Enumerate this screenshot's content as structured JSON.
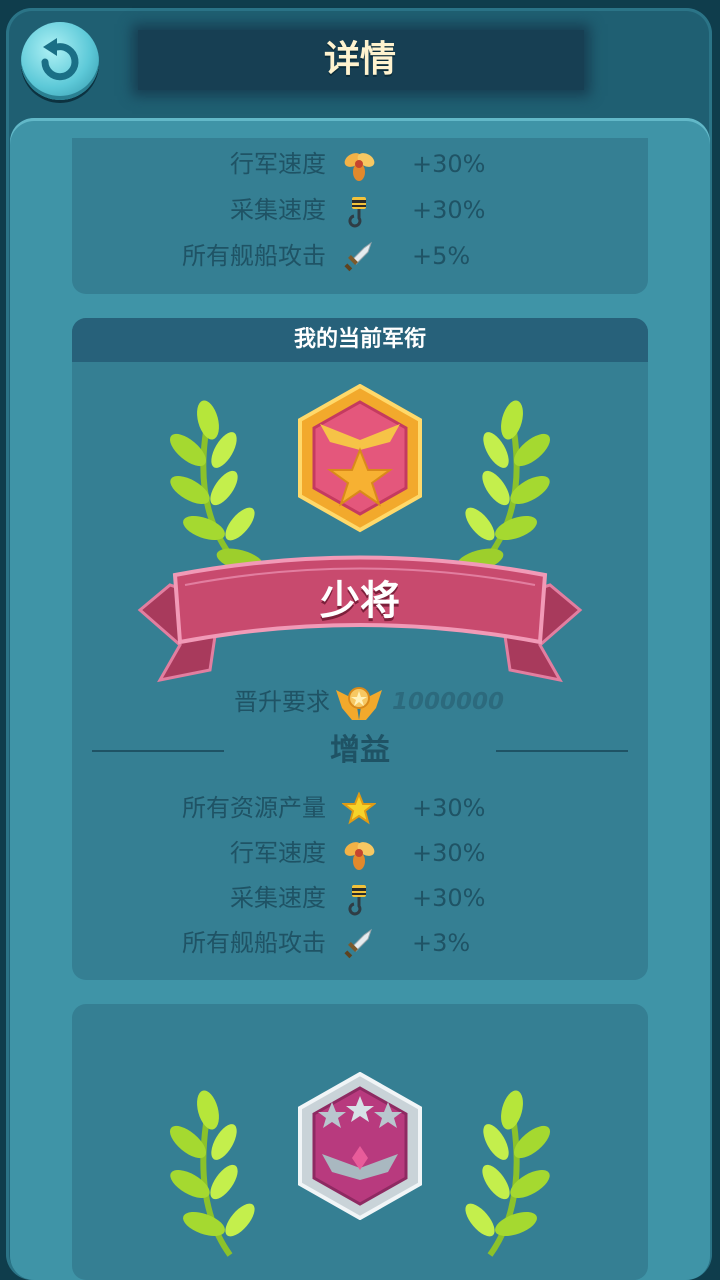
{
  "header": {
    "title": "详情",
    "back_icon": "back-arrow-icon"
  },
  "top_card": {
    "rows": [
      {
        "label": "行军速度",
        "icon": "propeller-icon",
        "value": "+30%"
      },
      {
        "label": "采集速度",
        "icon": "crane-hook-icon",
        "value": "+30%"
      },
      {
        "label": "所有舰船攻击",
        "icon": "sword-icon",
        "value": "+5%"
      }
    ]
  },
  "current_rank": {
    "header": "我的当前军衔",
    "rank_name": "少将",
    "badge_icon": "rank-badge-star-icon",
    "promotion_label": "晋升要求",
    "promotion_icon": "wings-emblem-icon",
    "promotion_value": "1000000",
    "gain_title": "增益",
    "rows": [
      {
        "label": "所有资源产量",
        "icon": "star-icon",
        "value": "+30%"
      },
      {
        "label": "行军速度",
        "icon": "propeller-icon",
        "value": "+30%"
      },
      {
        "label": "采集速度",
        "icon": "crane-hook-icon",
        "value": "+30%"
      },
      {
        "label": "所有舰船攻击",
        "icon": "sword-icon",
        "value": "+3%"
      }
    ]
  },
  "next_rank": {
    "badge_icon": "rank-badge-three-stars-icon"
  },
  "colors": {
    "panel": "#3f94a7",
    "card": "#357f93",
    "ribbon": "#c84a6e",
    "laurel": "#b6e63a",
    "gold": "#f2a92c"
  }
}
